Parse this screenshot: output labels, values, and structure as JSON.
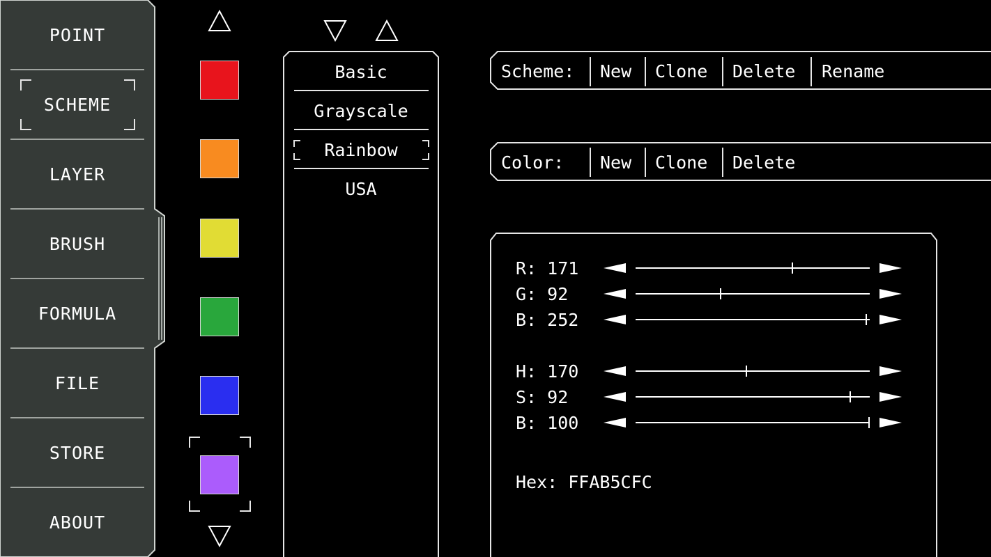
{
  "nav": {
    "items": [
      {
        "label": "POINT"
      },
      {
        "label": "SCHEME",
        "selected": true
      },
      {
        "label": "LAYER"
      },
      {
        "label": "BRUSH"
      },
      {
        "label": "FORMULA"
      },
      {
        "label": "FILE"
      },
      {
        "label": "STORE"
      },
      {
        "label": "ABOUT"
      }
    ],
    "background_color": "#353a37",
    "border_color": "#d0d4d0"
  },
  "swatches": {
    "colors": [
      "#e8141c",
      "#f88b20",
      "#e1dc34",
      "#29a73c",
      "#2a2ef0",
      "#ab5cfc"
    ],
    "selected_index": 5,
    "scroll_up_icon": "triangle-up-icon",
    "scroll_down_icon": "triangle-down-icon"
  },
  "scheme_list": {
    "items": [
      {
        "label": "Basic"
      },
      {
        "label": "Grayscale"
      },
      {
        "label": "Rainbow",
        "selected": true
      },
      {
        "label": "USA"
      }
    ],
    "move_down_icon": "triangle-down-icon",
    "move_up_icon": "triangle-up-icon"
  },
  "scheme_toolbar": {
    "label": "Scheme:",
    "new": "New",
    "clone": "Clone",
    "delete": "Delete",
    "rename": "Rename"
  },
  "color_toolbar": {
    "label": "Color:",
    "new": "New",
    "clone": "Clone",
    "delete": "Delete"
  },
  "color_panel": {
    "sliders": [
      {
        "label": "R: 171",
        "value": 171,
        "max": 255
      },
      {
        "label": "G: 92",
        "value": 92,
        "max": 255
      },
      {
        "label": "B: 252",
        "value": 252,
        "max": 255
      },
      {
        "label": "H: 170",
        "value": 170,
        "max": 360
      },
      {
        "label": "S: 92",
        "value": 92,
        "max": 100
      },
      {
        "label": "B: 100",
        "value": 100,
        "max": 100
      }
    ],
    "hex_label": "Hex: FFAB5CFC"
  }
}
